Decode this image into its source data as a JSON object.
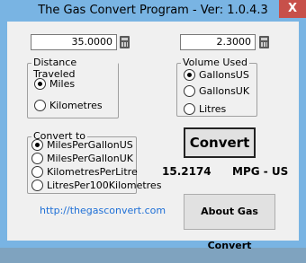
{
  "window": {
    "title": "The Gas Convert Program - Ver: 1.0.4.3",
    "close_label": "X"
  },
  "distance": {
    "value": "35.0000",
    "group_label": "Distance Traveled",
    "options": [
      "Miles",
      "Kilometres"
    ],
    "selected": "Miles"
  },
  "volume": {
    "value": "2.3000",
    "group_label": "Volume Used",
    "options": [
      "GallonsUS",
      "GallonsUK",
      "Litres"
    ],
    "selected": "GallonsUS"
  },
  "convert_to": {
    "group_label": "Convert to",
    "options": [
      "MilesPerGallonUS",
      "MilesPerGallonUK",
      "KilometresPerLitre",
      "LitresPer100Kilometres"
    ],
    "selected": "MilesPerGallonUS"
  },
  "buttons": {
    "convert_label": "Convert",
    "about_label": "About Gas Convert"
  },
  "result": {
    "value": "15.2174",
    "unit": "MPG - US"
  },
  "link": {
    "text": "http://thegasconvert.com"
  },
  "icons": {
    "calculator": "calculator-icon",
    "close": "close-icon"
  },
  "colors": {
    "titlebar": "#79b4e3",
    "close": "#c7504a",
    "link": "#1e6fd6"
  }
}
